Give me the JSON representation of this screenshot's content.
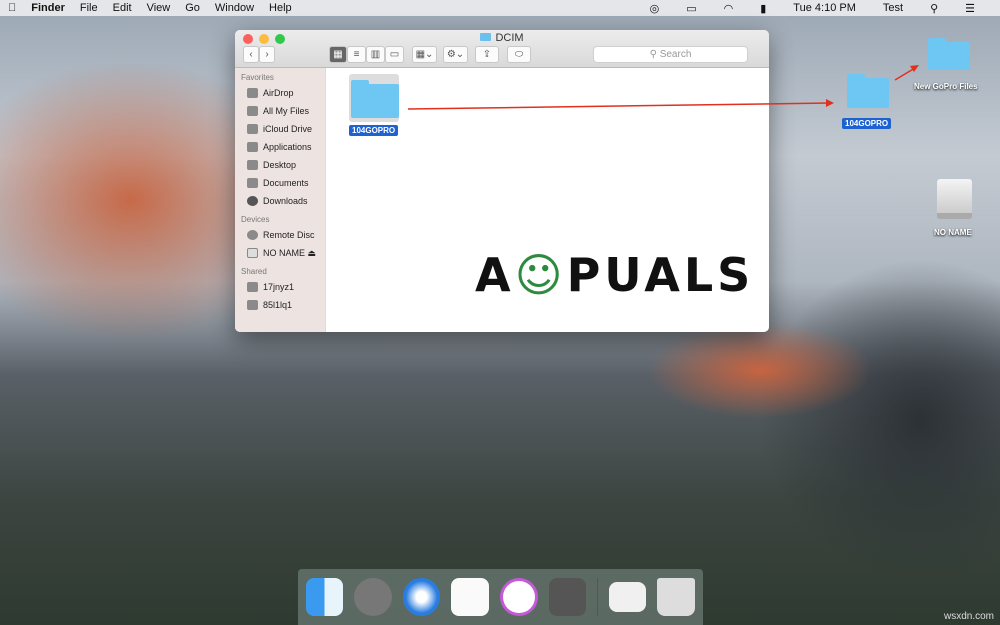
{
  "menubar": {
    "app": "Finder",
    "items": [
      "File",
      "Edit",
      "View",
      "Go",
      "Window",
      "Help"
    ],
    "clock": "Tue 4:10 PM",
    "user": "Test"
  },
  "window": {
    "title": "DCIM",
    "search_placeholder": "Search",
    "sidebar": {
      "favorites_header": "Favorites",
      "favorites": [
        "AirDrop",
        "All My Files",
        "iCloud Drive",
        "Applications",
        "Desktop",
        "Documents",
        "Downloads"
      ],
      "devices_header": "Devices",
      "devices": [
        "Remote Disc",
        "NO NAME"
      ],
      "shared_header": "Shared",
      "shared": [
        "17jnyz1",
        "85l1lq1"
      ]
    },
    "folder": "104GOPRO"
  },
  "desktop": {
    "dragged_folder": "104GOPRO",
    "target_folder": "New GoPro Files",
    "drive": "NO NAME"
  },
  "logo": "APPUALS",
  "watermark": "wsxdn.com",
  "dock": [
    "Finder",
    "Launchpad",
    "Safari",
    "Reminders",
    "iTunes",
    "System Preferences",
    "Downloads Stack",
    "Trash"
  ]
}
